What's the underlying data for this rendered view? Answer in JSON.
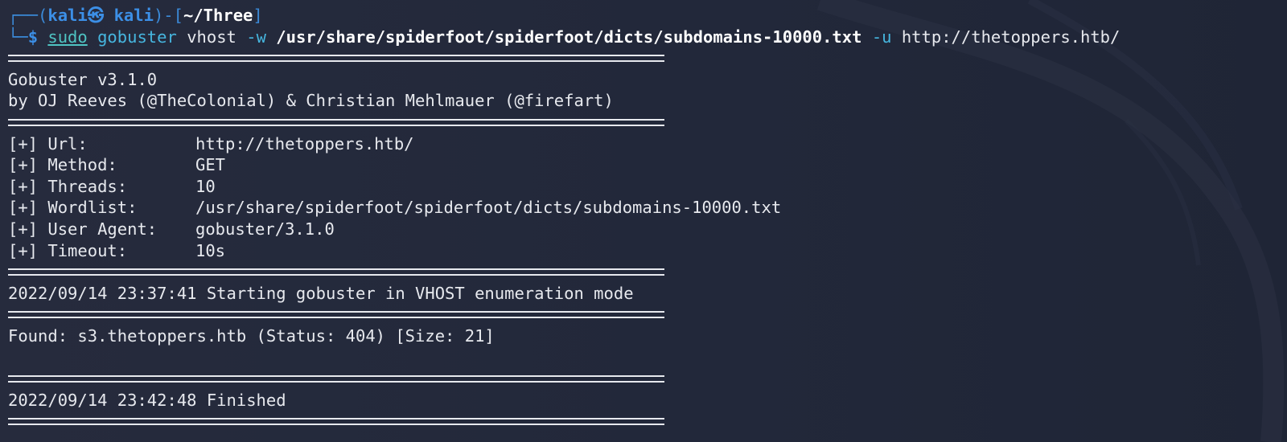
{
  "prompt": {
    "frame_top_left": "┌──(",
    "user": "kali㉿ kali",
    "frame_mid": ")-[",
    "dir": "~/Three",
    "frame_end": "]",
    "frame_bottom": "└─",
    "dollar": "$"
  },
  "command": {
    "sudo": "sudo",
    "program": "gobuster",
    "mode": "vhost",
    "wordlist_flag": "-w",
    "wordlist_path": "/usr/share/spiderfoot/spiderfoot/dicts/subdomains-10000.txt",
    "url_flag": "-u",
    "url": "http://thetoppers.htb/"
  },
  "banner": {
    "title": "Gobuster v3.1.0",
    "authors": "by OJ Reeves (@TheColonial) & Christian Mehlmauer (@firefart)"
  },
  "config": [
    {
      "label": "[+] Url:",
      "value": "http://thetoppers.htb/"
    },
    {
      "label": "[+] Method:",
      "value": "GET"
    },
    {
      "label": "[+] Threads:",
      "value": "10"
    },
    {
      "label": "[+] Wordlist:",
      "value": "/usr/share/spiderfoot/spiderfoot/dicts/subdomains-10000.txt"
    },
    {
      "label": "[+] User Agent:",
      "value": "gobuster/3.1.0"
    },
    {
      "label": "[+] Timeout:",
      "value": "10s"
    }
  ],
  "start_msg": "2022/09/14 23:37:41 Starting gobuster in VHOST enumeration mode",
  "found_msg": "Found: s3.thetoppers.htb (Status: 404) [Size: 21]",
  "finish_msg": "2022/09/14 23:42:48 Finished",
  "colors": {
    "background": "#23293a",
    "text": "#e7e9ee",
    "prompt_blue": "#3c8fe6",
    "command_cyan": "#46b6df"
  }
}
